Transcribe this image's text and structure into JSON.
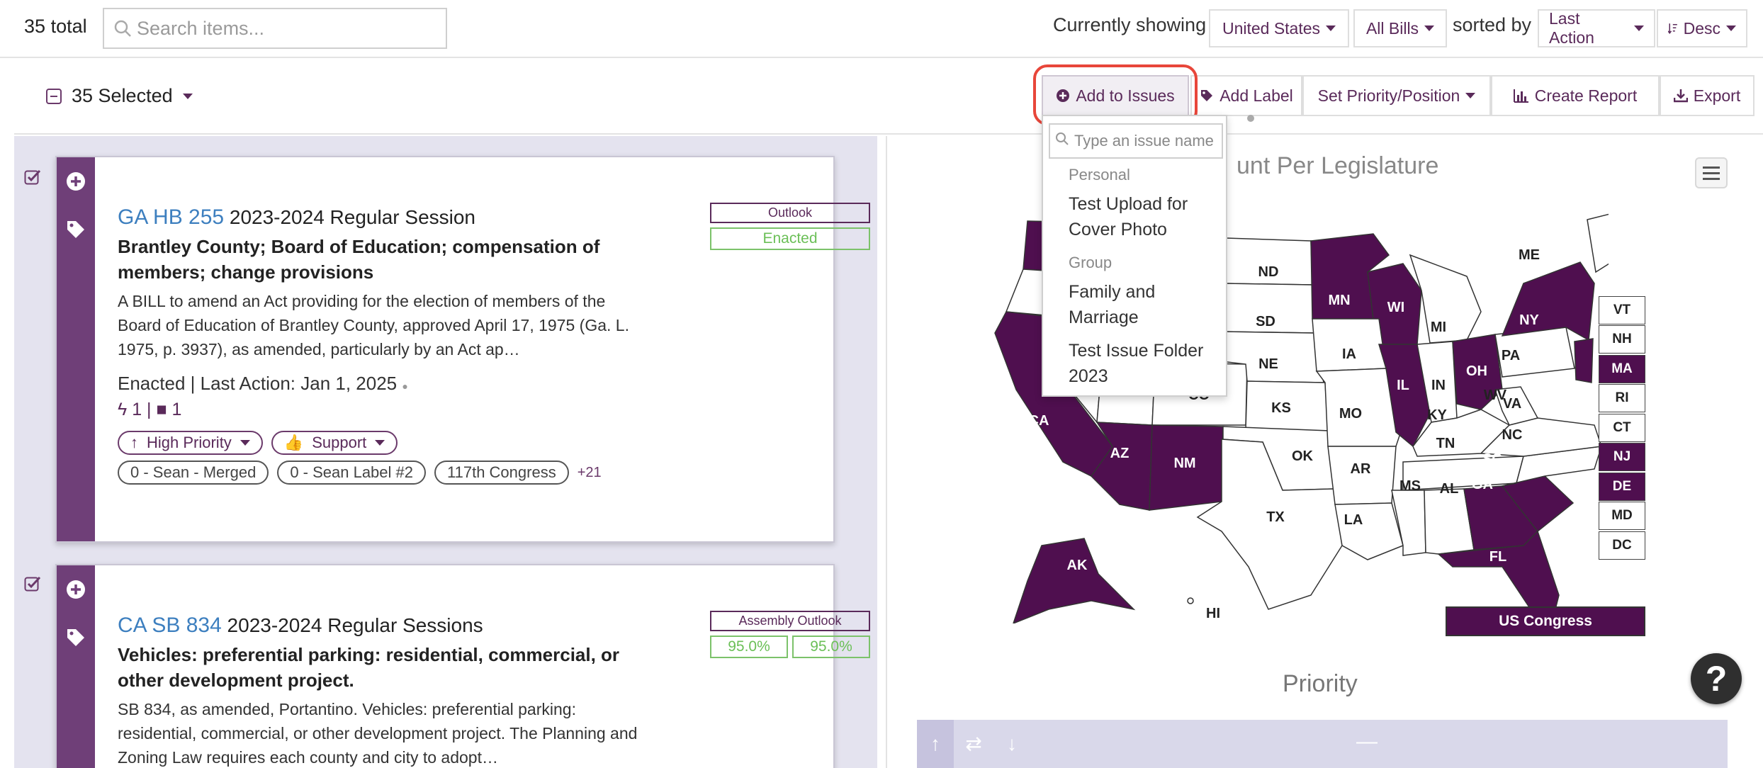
{
  "topbar": {
    "total_count": "35",
    "total_label": "total",
    "search_placeholder": "Search items...",
    "showing_label": "Currently showing",
    "region": "United States",
    "bill_filter": "All Bills",
    "sorted_label": "sorted by",
    "sort_field": "Last Action",
    "sort_order": "Desc"
  },
  "actionbar": {
    "selected_label": "35 Selected",
    "add_to_issues": "Add to Issues",
    "add_label": "Add Label",
    "set_priority": "Set Priority/Position",
    "create_report": "Create Report",
    "export": "Export"
  },
  "dropdown": {
    "search_placeholder": "Type an issue name",
    "groups": [
      {
        "label": "Personal",
        "items": [
          "Test Upload for Cover Photo"
        ]
      },
      {
        "label": "Group",
        "items": [
          "Family and Marriage",
          "Test Issue Folder 2023"
        ]
      }
    ]
  },
  "bills": [
    {
      "id": "GA HB 255",
      "session": "2023-2024 Regular Session",
      "title": "Brantley County; Board of Education; compensation of members; change provisions",
      "description": "A BILL to amend an Act providing for the election of members of the Board of Education of Brantley County, approved April 17, 1975 (Ga. L. 1975, p. 3937), as amended, particularly by an Act ap…",
      "status": "Enacted | Last Action: Jan 1, 2025",
      "count_a": "1",
      "count_b": "1",
      "outlook_label": "Outlook",
      "outlook_value": "Enacted",
      "priority": "High Priority",
      "position": "Support",
      "labels": [
        "0 - Sean - Merged",
        "0 - Sean Label #2",
        "117th Congress"
      ],
      "more_labels": "+21"
    },
    {
      "id": "CA SB 834",
      "session": "2023-2024 Regular Sessions",
      "title": "Vehicles: preferential parking: residential, commercial, or other development project.",
      "description": "SB 834, as amended, Portantino. Vehicles: preferential parking: residential, commercial, or other development project. The Planning and Zoning Law requires each county and city to adopt…",
      "outlook_label": "Assembly Outlook",
      "outlook_values": [
        "95.0%",
        "95.0%"
      ]
    }
  ],
  "map": {
    "title": "unt Per Legislature",
    "highlighted": [
      "WA",
      "CA",
      "AZ",
      "NM",
      "MN",
      "WI",
      "IL",
      "OH",
      "NY",
      "NJ",
      "MA",
      "DE",
      "GA",
      "SC",
      "FL",
      "AK"
    ],
    "labels": [
      "CA",
      "AZ",
      "NM",
      "ND",
      "SD",
      "NE",
      "KS",
      "OK",
      "TX",
      "MN",
      "WI",
      "IA",
      "MO",
      "AR",
      "LA",
      "IL",
      "IN",
      "MI",
      "OH",
      "KY",
      "TN",
      "MS",
      "AL",
      "GA",
      "SC",
      "NC",
      "VA",
      "WV",
      "PA",
      "NY",
      "ME",
      "FL",
      "AK",
      "HI",
      "CO"
    ],
    "small_states": [
      "VT",
      "NH",
      "MA",
      "RI",
      "CT",
      "NJ",
      "DE",
      "MD",
      "DC"
    ],
    "small_states_on": [
      "MA",
      "NJ",
      "DE"
    ],
    "congress_label": "US Congress",
    "fill_color": "#4f0f4f"
  },
  "priority_section": {
    "title": "Priority",
    "dash": "—"
  },
  "help": {
    "label": "?"
  }
}
